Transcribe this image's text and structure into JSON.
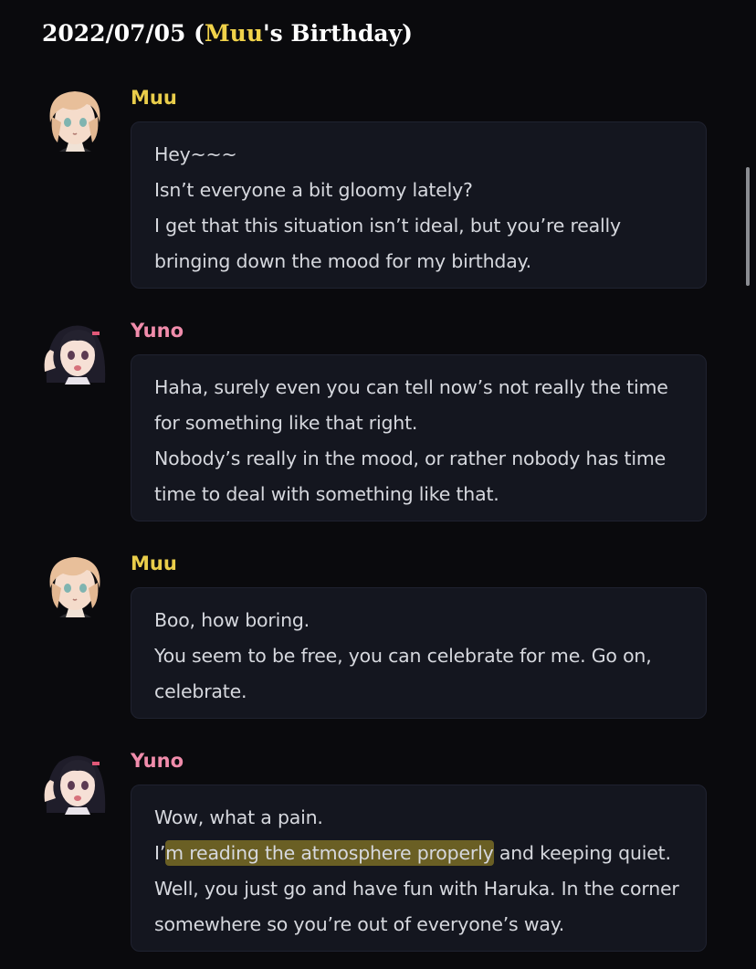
{
  "header": {
    "date": "2022/07/05",
    "paren_open": " (",
    "name": "Muu",
    "suffix": "'s Birthday)"
  },
  "messages": [
    {
      "speaker": "Muu",
      "lines": [
        "Hey~~~",
        "Isn’t everyone a bit gloomy lately?",
        "I get that this situation isn’t ideal, but you’re really",
        "bringing down the mood for my birthday."
      ]
    },
    {
      "speaker": "Yuno",
      "lines": [
        "Haha, surely even you can tell now’s not really the time",
        "for something like that right.",
        "Nobody’s really in the mood, or rather nobody has time",
        "time to deal with something like that."
      ]
    },
    {
      "speaker": "Muu",
      "lines": [
        "Boo, how boring.",
        "You seem to be free, you can celebrate for me. Go on,",
        "celebrate."
      ]
    },
    {
      "speaker": "Yuno",
      "lines": [
        "Wow, what a pain.",
        "",
        "Well, you just go and have fun with Haruka. In the corner",
        "somewhere so you’re out of everyone’s way."
      ],
      "highlight_line": {
        "before": "I’",
        "highlighted": "m reading the atmosphere properly",
        "after": " and keeping quiet."
      }
    }
  ],
  "colors": {
    "background": "#0a0a0d",
    "bubble": "#14161f",
    "muu_name": "#e9cd4a",
    "yuno_name": "#f08cab",
    "header_highlight": "#f0d24a",
    "text": "#d6d8de",
    "highlight": "#b09c28"
  },
  "icons": {
    "muu_avatar": "muu-avatar",
    "yuno_avatar": "yuno-avatar"
  }
}
